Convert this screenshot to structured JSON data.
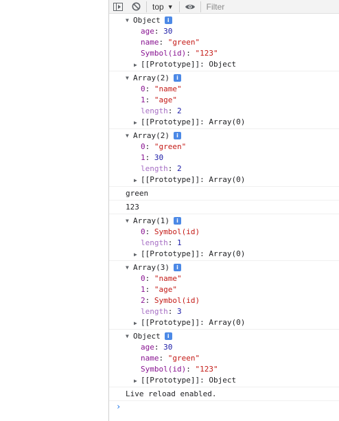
{
  "toolbar": {
    "context_label": "top",
    "filter_placeholder": "Filter"
  },
  "console": {
    "messages": [
      {
        "type": "object",
        "header": "Object",
        "badge": "i",
        "props": [
          {
            "key": "age",
            "sep": ": ",
            "value": "30",
            "vtype": "number"
          },
          {
            "key": "name",
            "sep": ": ",
            "value": "\"green\"",
            "vtype": "string"
          },
          {
            "key": "Symbol(id)",
            "sep": ": ",
            "value": "\"123\"",
            "vtype": "string"
          }
        ],
        "proto": "[[Prototype]]: Object"
      },
      {
        "type": "object",
        "header": "Array(2)",
        "badge": "i",
        "props": [
          {
            "key": "0",
            "sep": ": ",
            "value": "\"name\"",
            "vtype": "string"
          },
          {
            "key": "1",
            "sep": ": ",
            "value": "\"age\"",
            "vtype": "string"
          },
          {
            "key": "length",
            "sep": ": ",
            "value": "2",
            "vtype": "number",
            "dim": true
          }
        ],
        "proto": "[[Prototype]]: Array(0)"
      },
      {
        "type": "object",
        "header": "Array(2)",
        "badge": "i",
        "props": [
          {
            "key": "0",
            "sep": ": ",
            "value": "\"green\"",
            "vtype": "string"
          },
          {
            "key": "1",
            "sep": ": ",
            "value": "30",
            "vtype": "number"
          },
          {
            "key": "length",
            "sep": ": ",
            "value": "2",
            "vtype": "number",
            "dim": true
          }
        ],
        "proto": "[[Prototype]]: Array(0)"
      },
      {
        "type": "text",
        "text": "green"
      },
      {
        "type": "text",
        "text": "123"
      },
      {
        "type": "object",
        "header": "Array(1)",
        "badge": "i",
        "props": [
          {
            "key": "0",
            "sep": ": ",
            "value": "Symbol(id)",
            "vtype": "symbol"
          },
          {
            "key": "length",
            "sep": ": ",
            "value": "1",
            "vtype": "number",
            "dim": true
          }
        ],
        "proto": "[[Prototype]]: Array(0)"
      },
      {
        "type": "object",
        "header": "Array(3)",
        "badge": "i",
        "props": [
          {
            "key": "0",
            "sep": ": ",
            "value": "\"name\"",
            "vtype": "string"
          },
          {
            "key": "1",
            "sep": ": ",
            "value": "\"age\"",
            "vtype": "string"
          },
          {
            "key": "2",
            "sep": ": ",
            "value": "Symbol(id)",
            "vtype": "symbol"
          },
          {
            "key": "length",
            "sep": ": ",
            "value": "3",
            "vtype": "number",
            "dim": true
          }
        ],
        "proto": "[[Prototype]]: Array(0)"
      },
      {
        "type": "object",
        "header": "Object",
        "badge": "i",
        "props": [
          {
            "key": "age",
            "sep": ": ",
            "value": "30",
            "vtype": "number"
          },
          {
            "key": "name",
            "sep": ": ",
            "value": "\"green\"",
            "vtype": "string"
          },
          {
            "key": "Symbol(id)",
            "sep": ": ",
            "value": "\"123\"",
            "vtype": "string"
          }
        ],
        "proto": "[[Prototype]]: Object"
      },
      {
        "type": "text",
        "text": "Live reload enabled."
      }
    ],
    "prompt": "›"
  },
  "colors": {
    "key": "#881391",
    "number": "#1a1aa6",
    "string": "#c41a16",
    "badge": "#4c89e6",
    "prompt": "#1a73e8"
  },
  "icons": [
    "sidebar-toggle-icon",
    "clear-console-icon",
    "eye-icon",
    "triangle-expanded-icon",
    "triangle-collapsed-icon",
    "info-icon"
  ]
}
